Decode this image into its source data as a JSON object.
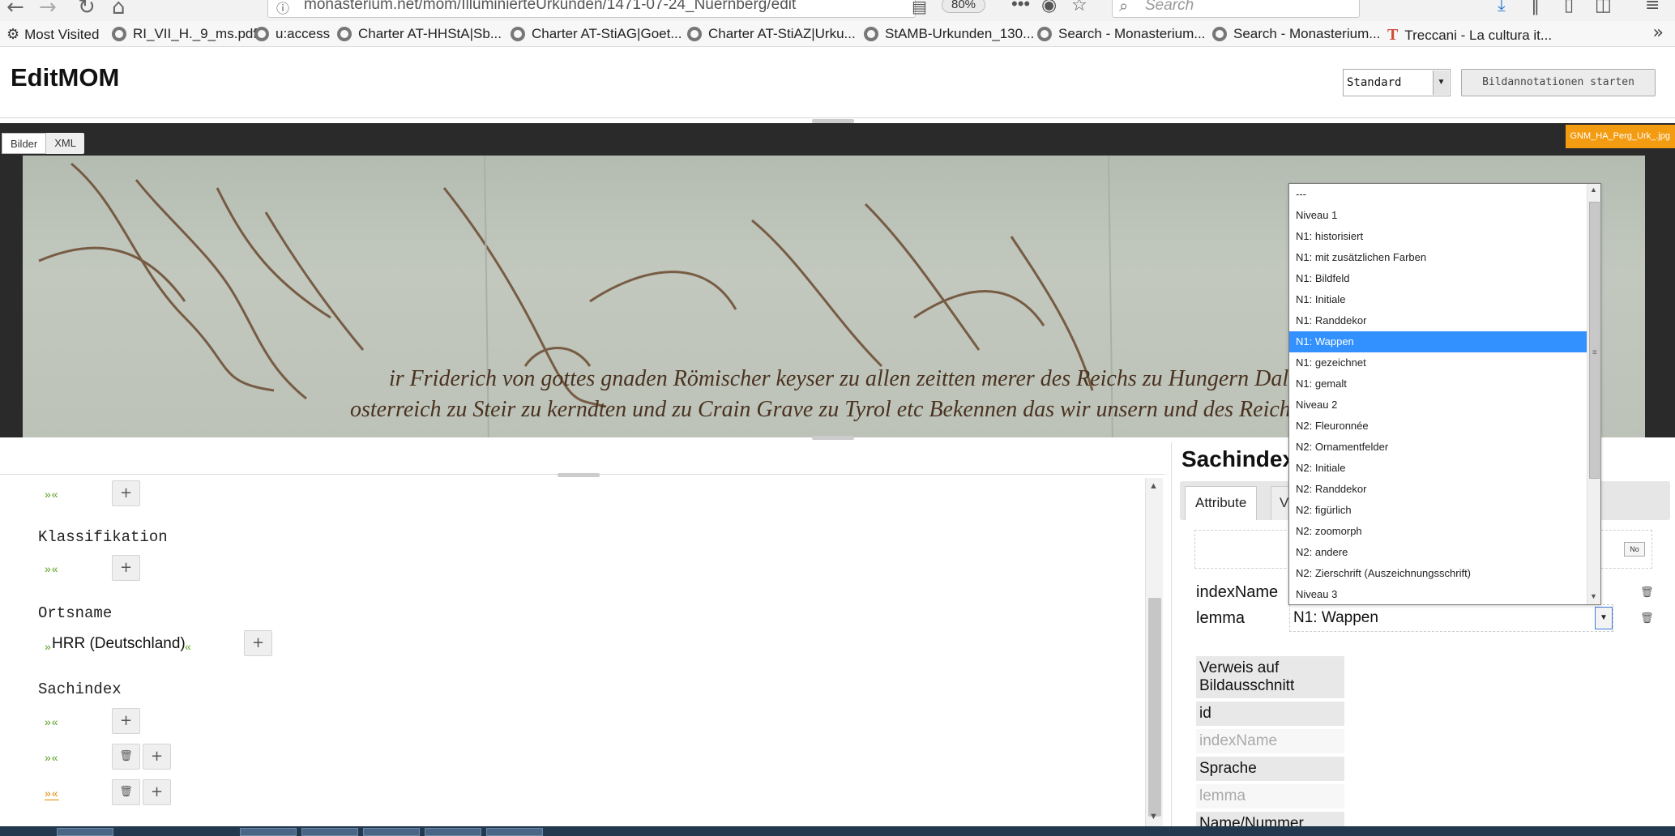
{
  "browser": {
    "url": "monasterium.net/mom/IlluminierteUrkunden/1471-07-24_Nuernberg/edit",
    "zoom": "80%",
    "more_glyph": "•••",
    "search_placeholder": "Search",
    "bookmarks": [
      "Most Visited",
      "RI_VII_H._9_ms.pdf",
      "u:access",
      "Charter AT-HHStA|Sb...",
      "Charter AT-StiAG|Goet...",
      "Charter AT-StiAZ|Urku...",
      "StAMB-Urkunden_130...",
      "Search - Monasterium...",
      "Search - Monasterium...",
      "Treccani - La cultura it..."
    ]
  },
  "app": {
    "title": "EditMOM",
    "mode_select_value": "Standard",
    "start_annotation_label": "Bildannotationen starten"
  },
  "viewer": {
    "tabs": [
      "Bilder",
      "XML"
    ],
    "filename": "GNM_HA_Perg_Urk_.jpg",
    "script_line_1": "ir Friderich von gottes gnaden Römischer keyser zu allen zeitten merer des Reichs zu Hungern Dalmacien Croacien et kunig",
    "script_line_2": "osterreich zu Steir zu kerndten und zu Crain Grave zu Tyrol etc Bekennen das wir unsern und des Reichs lieben getrewen den"
  },
  "left_panel": {
    "top_quote": "»«",
    "sections": {
      "klassifikation": {
        "label": "Klassifikation",
        "quote": "»«"
      },
      "ortsname": {
        "label": "Ortsname",
        "value": "HRR (Deutschland)",
        "open": "»",
        "close": "«"
      },
      "sachindex": {
        "label": "Sachindex",
        "quotes": [
          "»«",
          "»«",
          "»«"
        ]
      }
    },
    "add_glyph": "+",
    "delete_glyph": "🗑"
  },
  "right_panel": {
    "title": "Sachindex",
    "tabs": {
      "attribute": "Attribute",
      "values": "Va"
    },
    "no_label": "No",
    "attrs": {
      "indexName": "indexName",
      "lemma": "lemma",
      "lemma_value": "N1: Wappen"
    },
    "reference": {
      "heading": "Verweis auf Bildausschnitt",
      "id": "id",
      "indexName_placeholder": "indexName",
      "sprache": "Sprache",
      "lemma_placeholder": "lemma",
      "name_partial": "Name/Nummer"
    }
  },
  "dropdown": {
    "options": [
      "---",
      "Niveau 1",
      "N1: historisiert",
      "N1: mit zusätzlichen Farben",
      "N1: Bildfeld",
      "N1: Initiale",
      "N1: Randdekor",
      "N1: Wappen",
      "N1: gezeichnet",
      "N1: gemalt",
      "Niveau 2",
      "N2: Fleuronnée",
      "N2: Ornamentfelder",
      "N2: Initiale",
      "N2: Randdekor",
      "N2: figürlich",
      "N2: zoomorph",
      "N2: andere",
      "N2: Zierschrift (Auszeichnungsschrift)",
      "Niveau 3"
    ],
    "selected_index": 7
  },
  "colors": {
    "selection": "#3391ff",
    "quote_green": "#5aa020",
    "badge_orange": "#f39c12"
  }
}
